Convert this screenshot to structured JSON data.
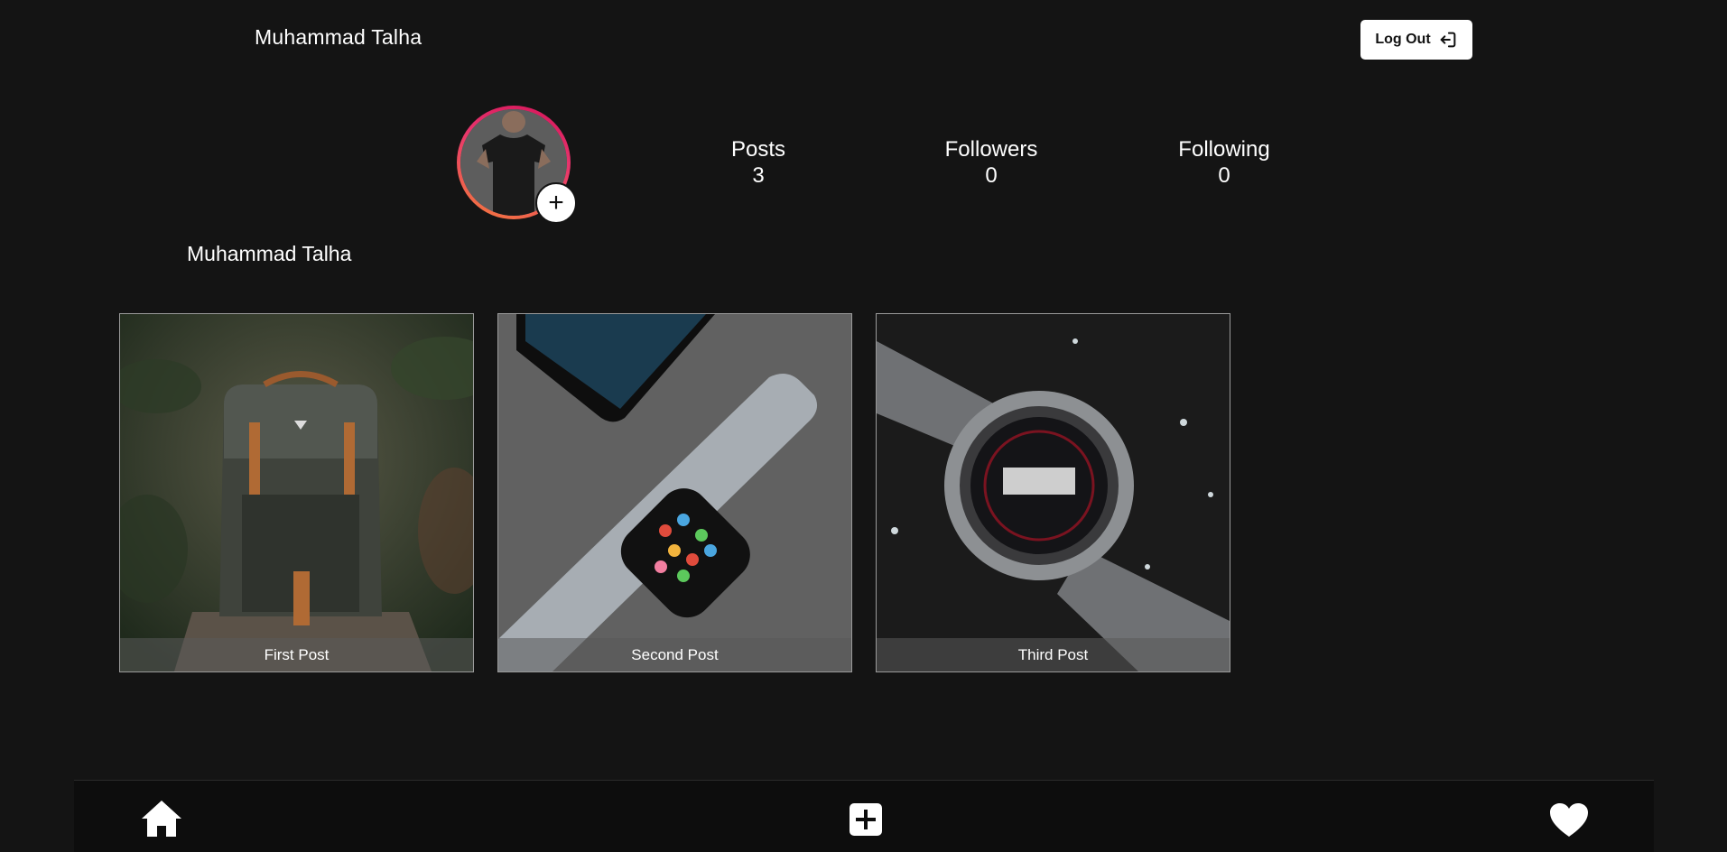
{
  "header": {
    "username": "Muhammad Talha",
    "logout_label": "Log Out"
  },
  "profile": {
    "display_name": "Muhammad Talha",
    "stats": [
      {
        "label": "Posts",
        "value": "3"
      },
      {
        "label": "Followers",
        "value": "0"
      },
      {
        "label": "Following",
        "value": "0"
      }
    ],
    "add_photo_symbol": "+"
  },
  "posts": [
    {
      "caption": "First Post",
      "image": "backpack-photo"
    },
    {
      "caption": "Second Post",
      "image": "apple-watch-photo"
    },
    {
      "caption": "Third Post",
      "image": "smartwatch-photo"
    }
  ],
  "bottom_nav": {
    "items": [
      {
        "icon": "home-icon"
      },
      {
        "icon": "add-square-icon"
      },
      {
        "icon": "heart-icon"
      }
    ]
  },
  "colors": {
    "background": "#141414",
    "nav_background": "#0d0d0d",
    "avatar_ring_start": "#d4145a",
    "avatar_ring_end": "#f47b3c"
  }
}
